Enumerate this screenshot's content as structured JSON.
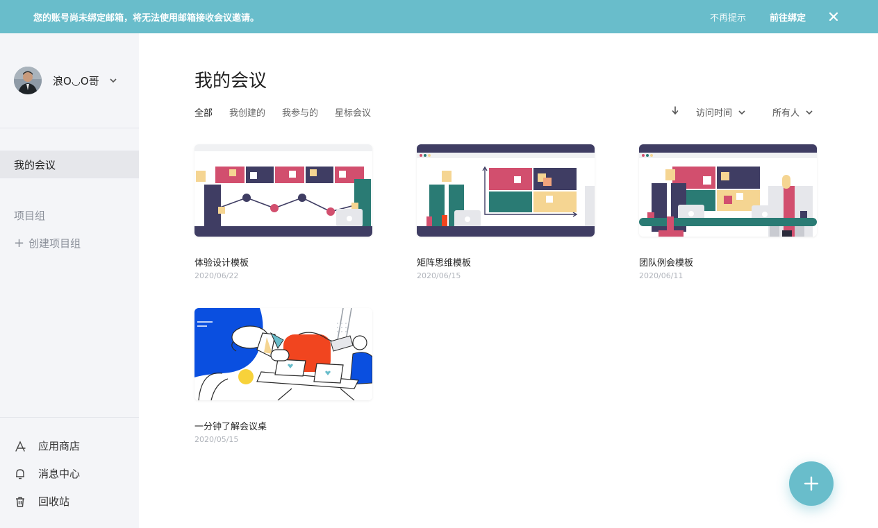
{
  "banner": {
    "message": "您的账号尚未绑定邮箱，将无法使用邮箱接收会议邀请。",
    "dismiss_label": "不再提示",
    "bind_label": "前往绑定",
    "close_icon": "close-icon"
  },
  "sidebar": {
    "user_name": "浪O◡O哥",
    "nav_active": "我的会议",
    "group_title": "项目组",
    "create_group_plus": "+",
    "create_group": "创建项目组",
    "bottom_items": [
      {
        "label": "应用商店",
        "icon": "app-store-icon"
      },
      {
        "label": "消息中心",
        "icon": "bell-icon"
      },
      {
        "label": "回收站",
        "icon": "trash-icon"
      }
    ]
  },
  "main": {
    "title": "我的会议",
    "tabs": [
      {
        "label": "全部",
        "active": true
      },
      {
        "label": "我创建的",
        "active": false
      },
      {
        "label": "我参与的",
        "active": false
      },
      {
        "label": "星标会议",
        "active": false
      }
    ],
    "sort_label": "访问时间",
    "owner_filter": "所有人",
    "cards": [
      {
        "title": "体验设计模板",
        "date": "2020/06/22"
      },
      {
        "title": "矩阵思维模板",
        "date": "2020/06/15"
      },
      {
        "title": "团队例会模板",
        "date": "2020/06/11"
      },
      {
        "title": "一分钟了解会议桌",
        "date": "2020/05/15"
      }
    ]
  },
  "colors": {
    "accent": "#69bdcb",
    "navy": "#3f3d63",
    "pink": "#d24f6e",
    "teal": "#2a7b74",
    "sand": "#f5d592",
    "blue": "#0a4fe0",
    "orange": "#f1451f"
  },
  "fab_icon": "plus-icon"
}
